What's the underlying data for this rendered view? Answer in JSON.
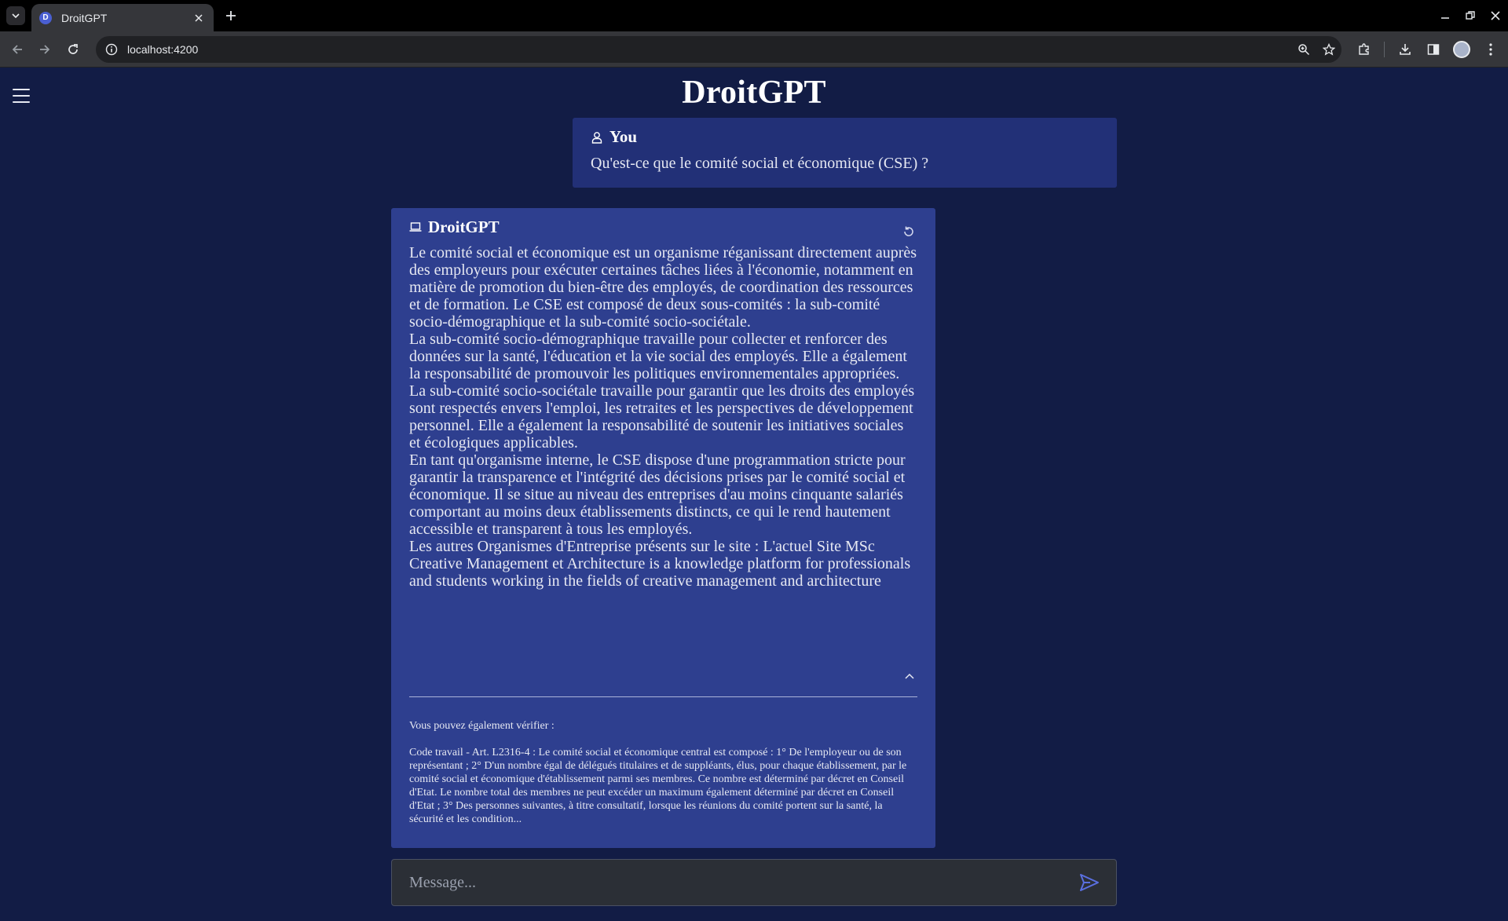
{
  "browser": {
    "tab_title": "DroitGPT",
    "tab_favicon_letter": "D",
    "url": "localhost:4200"
  },
  "app": {
    "title": "DroitGPT",
    "user_label": "You",
    "user_message": "Qu'est-ce que le comité social et économique (CSE) ?",
    "bot_label": "DroitGPT",
    "answer_paragraphs": [
      "Le comité social et économique est un organisme réganissant directement auprès des employeurs pour exécuter certaines tâches liées à l'économie, notamment en matière de promotion du bien-être des employés, de coordination des ressources et de formation. Le CSE est composé de deux sous-comités : la sub-comité socio-démographique et la sub-comité socio-sociétale.",
      "La sub-comité socio-démographique travaille pour collecter et renforcer des données sur la santé, l'éducation et la vie social des employés. Elle a également la responsabilité de promouvoir les politiques environnementales appropriées.",
      "La sub-comité socio-sociétale travaille pour garantir que les droits des employés sont respectés envers l'emploi, les retraites et les perspectives de développement personnel. Elle a également la responsabilité de soutenir les initiatives sociales et écologiques applicables.",
      "En tant qu'organisme interne, le CSE dispose d'une programmation stricte pour garantir la transparence et l'intégrité des décisions prises par le comité social et économique. Il se situe au niveau des entreprises d'au moins cinquante salariés comportant au moins deux établissements distincts, ce qui le rend hautement accessible et transparent à tous les employés.",
      "Les autres Organismes d'Entreprise présents sur le site : L'actuel Site MSc Creative Management et Architecture is a knowledge platform for professionals and students working in the fields of creative management and architecture"
    ],
    "sources_label": "Vous pouvez également vérifier :",
    "source_text": "Code travail - Art. L2316-4 : Le comité social et économique central est composé : 1° De l'employeur ou de son représentant ; 2° D'un nombre égal de délégués titulaires et de suppléants, élus, pour chaque établissement, par le comité social et économique d'établissement parmi ses membres. Ce nombre est déterminé par décret en Conseil d'Etat. Le nombre total des membres ne peut excéder un maximum également déterminé par décret en Conseil d'Etat ; 3° Des personnes suivantes, à titre consultatif, lorsque les réunions du comité portent sur la santé, la sécurité et les condition...",
    "composer_placeholder": "Message..."
  },
  "colors": {
    "page_bg": "#121c45",
    "user_card_bg": "#223077",
    "bot_card_bg": "#2e3f8f",
    "accent": "#4a5fd1"
  }
}
